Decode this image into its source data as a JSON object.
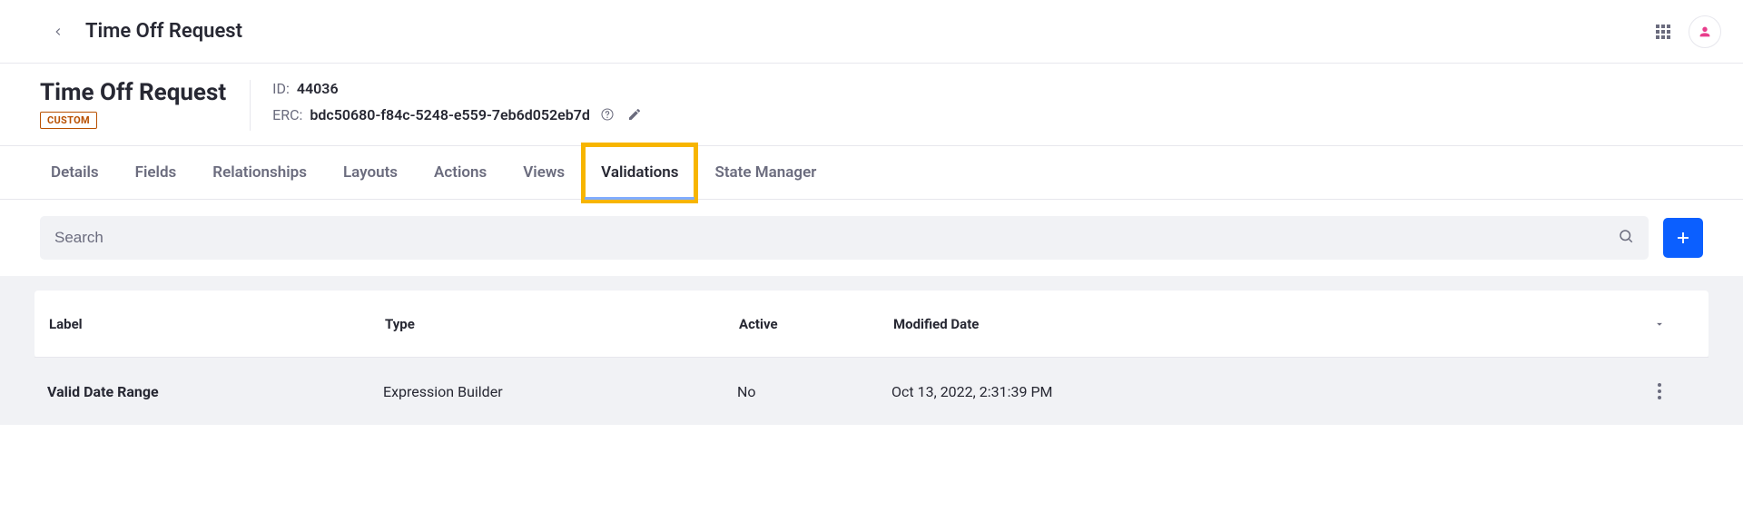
{
  "top": {
    "title": "Time Off Request"
  },
  "header": {
    "title": "Time Off Request",
    "badge": "CUSTOM",
    "id_label": "ID:",
    "id_value": "44036",
    "erc_label": "ERC:",
    "erc_value": "bdc50680-f84c-5248-e559-7eb6d052eb7d"
  },
  "tabs": [
    {
      "label": "Details"
    },
    {
      "label": "Fields"
    },
    {
      "label": "Relationships"
    },
    {
      "label": "Layouts"
    },
    {
      "label": "Actions"
    },
    {
      "label": "Views"
    },
    {
      "label": "Validations"
    },
    {
      "label": "State Manager"
    }
  ],
  "search": {
    "placeholder": "Search"
  },
  "table": {
    "columns": {
      "label": "Label",
      "type": "Type",
      "active": "Active",
      "modified": "Modified Date"
    },
    "rows": [
      {
        "label": "Valid Date Range",
        "type": "Expression Builder",
        "active": "No",
        "modified": "Oct 13, 2022, 2:31:39 PM"
      }
    ]
  }
}
